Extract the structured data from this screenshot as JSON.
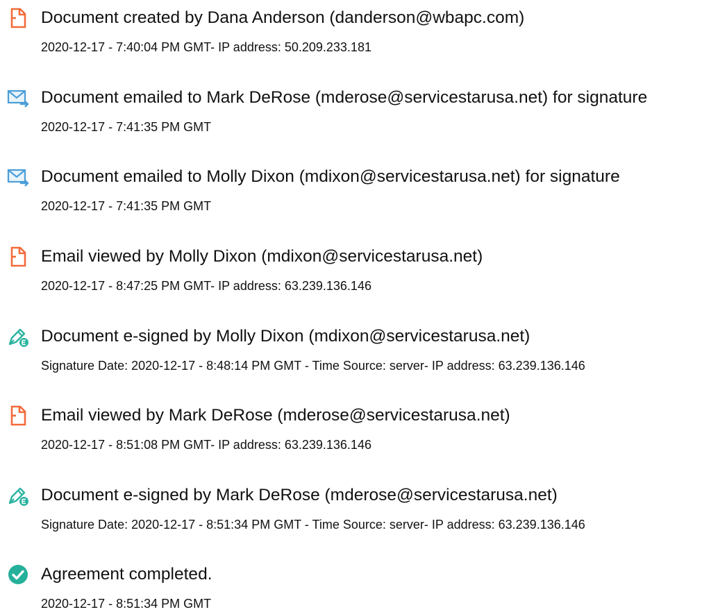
{
  "colors": {
    "doc_icon": "#f26b3a",
    "email_icon": "#4a9ed8",
    "sign_icon": "#2bb3a0",
    "complete_icon": "#25b09b",
    "text": "#111111"
  },
  "events": [
    {
      "icon": "document-icon",
      "title": "Document created by Dana Anderson (danderson@wbapc.com)",
      "detail": "2020-12-17 - 7:40:04 PM GMT- IP address: 50.209.233.181"
    },
    {
      "icon": "email-sent-icon",
      "title": "Document emailed to Mark DeRose (mderose@servicestarusa.net) for signature",
      "detail": "2020-12-17 - 7:41:35 PM GMT"
    },
    {
      "icon": "email-sent-icon",
      "title": "Document emailed to Molly Dixon (mdixon@servicestarusa.net) for signature",
      "detail": "2020-12-17 - 7:41:35 PM GMT"
    },
    {
      "icon": "document-icon",
      "title": "Email viewed by Molly Dixon (mdixon@servicestarusa.net)",
      "detail": "2020-12-17 - 8:47:25 PM GMT- IP address: 63.239.136.146"
    },
    {
      "icon": "e-sign-pen-icon",
      "title": "Document e-signed by Molly Dixon (mdixon@servicestarusa.net)",
      "detail": "Signature Date: 2020-12-17 - 8:48:14 PM GMT - Time Source: server- IP address: 63.239.136.146"
    },
    {
      "icon": "document-icon",
      "title": "Email viewed by Mark DeRose (mderose@servicestarusa.net)",
      "detail": "2020-12-17 - 8:51:08 PM GMT- IP address: 63.239.136.146"
    },
    {
      "icon": "e-sign-pen-icon",
      "title": "Document e-signed by Mark DeRose (mderose@servicestarusa.net)",
      "detail": "Signature Date: 2020-12-17 - 8:51:34 PM GMT - Time Source: server- IP address: 63.239.136.146"
    },
    {
      "icon": "check-circle-icon",
      "title": "Agreement completed.",
      "detail": "2020-12-17 - 8:51:34 PM GMT"
    }
  ]
}
